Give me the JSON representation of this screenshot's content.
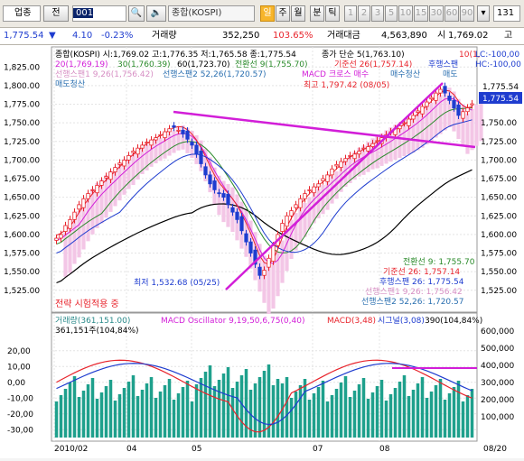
{
  "toolbar": {
    "market_select": "업종",
    "type_label": "전",
    "code": "001",
    "name": "종합(KOSPI)",
    "tabs": [
      "일",
      "주",
      "월",
      "분",
      "틱"
    ],
    "minute_options": [
      "1",
      "2",
      "3",
      "5",
      "10",
      "15",
      "30",
      "60",
      "90"
    ],
    "count": "131"
  },
  "quote": {
    "price": "1,775.54",
    "change": "4.10",
    "change_pct": "-0.23%",
    "volume_label": "거래량",
    "volume": "352,250",
    "volume_ratio": "103.65%",
    "amount_label": "거래대금",
    "amount": "4,563,890",
    "open_label": "시",
    "open": "1,769.02",
    "high_label": "고"
  },
  "price_panel": {
    "line1": "종합(KOSPI) 시:1,769.02 고:1,776.35 저:1,765.58 종:1,775.54",
    "line1b": "종가 단순 5(1,763.10)",
    "line1c": "10(1,",
    "line1d": "LC:-100,00",
    "line2a": "20(1,769.19)",
    "line2b": "30(1,760.39)",
    "line2c": "60(1,723.70)",
    "line2d": "전환선 9(1,755.70)",
    "line2e": "기준선 26(1,757.14)",
    "line2f": "후행스팬",
    "line2g": "HC:-100,00",
    "line3a": "선행스팬1 9,26(1,756.42)",
    "line3b": "선행스팬2 52,26(1,720.57)",
    "line3c": "MACD 크로스 매수",
    "line3d": "매수청산",
    "line3e": "매도",
    "line4": "매도청산",
    "high_marker": "최고 1,797.42 (08/05)",
    "low_marker": "최저 1,532.68 (05/25)",
    "strategy": "전략 시험적용 중",
    "price_box": "1,775.54",
    "legend": [
      {
        "label": "전환선 9",
        "value": "1,755.70"
      },
      {
        "label": "기준선 26",
        "value": "1,757.14"
      },
      {
        "label": "후행스팬 26",
        "value": "1,775.54"
      },
      {
        "label": "선행스팬1 9,26",
        "value": "1,756.42"
      },
      {
        "label": "선행스팬2 52,26",
        "value": "1,720.57"
      }
    ],
    "y_ticks": [
      "1,825.00",
      "1,800.00",
      "1,775.00",
      "1,750.00",
      "1,725.00",
      "1,700.00",
      "1,675.00",
      "1,650.00",
      "1,625.00",
      "1,600.00",
      "1,575.00",
      "1,550.00",
      "1,525.00"
    ],
    "right_ticks": [
      "1,750.00",
      "1,725.00",
      "1,700.00",
      "1,675.00",
      "1,650.00",
      "1,625.00",
      "1,600.00",
      "1,575.00",
      "1,550.00",
      "1,525.00"
    ],
    "right_top": "1,775.54"
  },
  "lower_panel": {
    "line1a": "거래량(361,151.00)",
    "line1b": "MACD Oscillator 9,19,50,6,75(0,40)",
    "line1c": "MACD(3,48)",
    "line1d": "시그널(3,08)",
    "line1e": "390(104,84%)",
    "line2": "361,151주(104,84%)",
    "y_ticks": [
      "20,00",
      "10,00",
      "0,00",
      "-10,00",
      "-20,00",
      "-30,00"
    ],
    "right_ticks": [
      "600,000",
      "500,000",
      "400,000",
      "300,000",
      "200,000",
      "100,000"
    ]
  },
  "x_axis": [
    "2010/02",
    "04",
    "05",
    "07",
    "08",
    "08/20"
  ],
  "colors": {
    "up": "#e8242c",
    "down": "#1e3ccf",
    "trendline": "#d21ed8",
    "volume": "#1ea08c",
    "cloud": "#f3c6e6"
  },
  "chart_data": {
    "type": "candlestick",
    "title": "종합(KOSPI)",
    "ylim": [
      1515,
      1835
    ],
    "last": {
      "open": 1769.02,
      "high": 1776.35,
      "low": 1765.58,
      "close": 1775.54
    },
    "series": [
      {
        "name": "20",
        "last": 1769.19
      },
      {
        "name": "30",
        "last": 1760.39
      },
      {
        "name": "60",
        "last": 1723.7
      },
      {
        "name": "전환선 9",
        "last": 1755.7
      },
      {
        "name": "기준선 26",
        "last": 1757.14
      },
      {
        "name": "선행스팬1 9,26",
        "last": 1756.42
      },
      {
        "name": "선행스팬2 52,26",
        "last": 1720.57
      }
    ],
    "closes": [
      1595,
      1600,
      1612,
      1620,
      1630,
      1640,
      1648,
      1655,
      1660,
      1666,
      1672,
      1678,
      1684,
      1690,
      1696,
      1700,
      1706,
      1712,
      1716,
      1720,
      1724,
      1727,
      1730,
      1734,
      1738,
      1742,
      1744,
      1740,
      1735,
      1728,
      1720,
      1708,
      1695,
      1680,
      1668,
      1660,
      1655,
      1650,
      1640,
      1630,
      1620,
      1605,
      1590,
      1575,
      1560,
      1545,
      1552,
      1568,
      1585,
      1600,
      1615,
      1625,
      1632,
      1640,
      1648,
      1655,
      1660,
      1664,
      1668,
      1675,
      1680,
      1688,
      1694,
      1698,
      1702,
      1706,
      1708,
      1712,
      1716,
      1718,
      1722,
      1726,
      1730,
      1734,
      1738,
      1742,
      1746,
      1750,
      1755,
      1760,
      1766,
      1772,
      1778,
      1784,
      1790,
      1795,
      1790,
      1780,
      1770,
      1760,
      1765,
      1770,
      1775.54
    ],
    "high_point": {
      "value": 1797.42,
      "date": "08/05"
    },
    "low_point": {
      "value": 1532.68,
      "date": "05/25"
    }
  }
}
